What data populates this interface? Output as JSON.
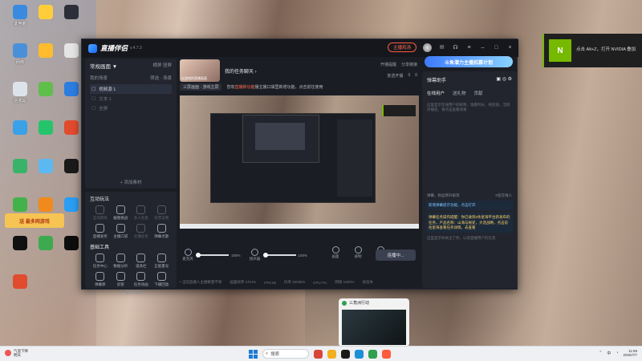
{
  "desktop": {
    "icons": [
      {
        "label": "此电脑",
        "color": "#3a8be0"
      },
      {
        "label": "",
        "color": "#ffcd3a"
      },
      {
        "label": "",
        "color": "#2c2f3a"
      },
      {
        "label": "网络",
        "color": "#4a90d9"
      },
      {
        "label": "",
        "color": "#ffbc2c"
      },
      {
        "label": "",
        "color": "#e5e5e5"
      },
      {
        "label": "回收站",
        "color": "#dde3ea"
      },
      {
        "label": "",
        "color": "#5fbf4a"
      },
      {
        "label": "",
        "color": "#2c7de0"
      },
      {
        "label": "",
        "color": "#3aa0e8"
      },
      {
        "label": "",
        "color": "#25c46b"
      },
      {
        "label": "",
        "color": "#e14b2e"
      },
      {
        "label": "",
        "color": "#3ab36a"
      },
      {
        "label": "",
        "color": "#5cb8f0"
      },
      {
        "label": "",
        "color": "#1a1a1a"
      },
      {
        "label": "",
        "color": "#43b24a"
      },
      {
        "label": "",
        "color": "#f08a1c"
      },
      {
        "label": "",
        "color": "#2a9df4"
      },
      {
        "label": "",
        "color": "#111"
      },
      {
        "label": "",
        "color": "#3eaa4f"
      },
      {
        "label": "",
        "color": "#0d0d0d"
      },
      {
        "label": "",
        "color": "#e14b2e"
      }
    ],
    "sticker_text": "送 最多网游戏"
  },
  "toast": {
    "logo": "N",
    "text": "点击 Alt+Z，打开 NVIDIA 叠加"
  },
  "app": {
    "name": "直播伴侣",
    "version": "v.4.7.3",
    "theme_button": "主播鸡汤",
    "left": {
      "scene_title": "常规画面 ▼",
      "scene_tab_a": "横屏",
      "scene_tab_b": "竖屏",
      "sources_header": "我的场景",
      "sources_filter": "筛选 · 场景",
      "sources": [
        {
          "label": "视频源 1",
          "selected": true
        },
        {
          "label": "文本 1",
          "selected": false
        },
        {
          "label": "全屏",
          "selected": false
        }
      ],
      "add_source": "+ 添加素材",
      "section_interact": "互动玩法",
      "interact_tools": [
        {
          "label": "互动游戏",
          "dim": true
        },
        {
          "label": "截图挑战",
          "dim": false
        },
        {
          "label": "多人连麦",
          "dim": true
        },
        {
          "label": "投票竞猜",
          "dim": true
        },
        {
          "label": "直播发奖",
          "dim": false
        },
        {
          "label": "主播口袋",
          "dim": false
        },
        {
          "label": "主播任务",
          "dim": true
        },
        {
          "label": "弹幕点歌",
          "dim": false
        }
      ],
      "section_basic": "基础工具",
      "basic_tools": [
        {
          "label": "任务中心",
          "dim": false
        },
        {
          "label": "数据分析",
          "dim": false
        },
        {
          "label": "道具栏",
          "dim": false
        },
        {
          "label": "正能量号",
          "dim": false
        },
        {
          "label": "弹幕库",
          "dim": false
        },
        {
          "label": "房管",
          "dim": false
        },
        {
          "label": "任务动画",
          "dim": false
        },
        {
          "label": "下播回放",
          "dim": false
        }
      ],
      "more": "— 更多功能"
    },
    "center": {
      "room_thumb_text": "玩游戏的直播画面",
      "room_title": "我的任务聊天 ›",
      "top_links": [
        "开播提醒",
        "分享链接"
      ],
      "stats": [
        "复选开播",
        "0",
        "0"
      ],
      "notice_tag": "三屏画面 · 游戏主屏",
      "notice_text": "您有",
      "notice_highlight": "直播新功能",
      "notice_text2": "播主播口袋里新增功能，点击前往使用",
      "mic_label": "麦克风",
      "mic_pct": "100%",
      "sys_label": "扬声器",
      "sys_pct": "100%",
      "right_ctrls": [
        "画面",
        "录制",
        "设置"
      ],
      "go_live": "连播中...",
      "status": [
        "• 当前直播人主播数量不够",
        "画面帧率 CPU%",
        "FPS:60",
        "码率 2000k/s",
        "CPU:7%",
        "网络 1000%",
        "帧丢失"
      ]
    },
    "right": {
      "banner": "斗鱼潜力主播招募计划",
      "title": "弹幕助手",
      "tabs": [
        "在线用户",
        "送礼物",
        "贡献"
      ],
      "desc": "这里显示在线用户的昵称、观看时长、经验值，活跃开播后，请点击查看效果",
      "msg_bar_left": "弹幕、粉丝牌升级等",
      "msg_bar_right": "0名在线人",
      "messages": [
        {
          "text": "新增弹幕提示功能，点击打开",
          "type": "blue"
        },
        {
          "text": "弹幕任务操作提醒：你已收到3条星海平台新发布的任务，产品名称：山海与秘史，大话战略，点击前往星海查看任务详情。去查看",
          "type": "yellow"
        }
      ],
      "footer": "这里显示你关注了你，以及直播用户的信息"
    }
  },
  "mini_window": {
    "title": "三角洲行动"
  },
  "taskbar": {
    "weather_temp": "气温下降",
    "weather_sub": "明天",
    "search": "搜索",
    "lang": "中",
    "time": "11:59",
    "date": "2025/7/7"
  }
}
